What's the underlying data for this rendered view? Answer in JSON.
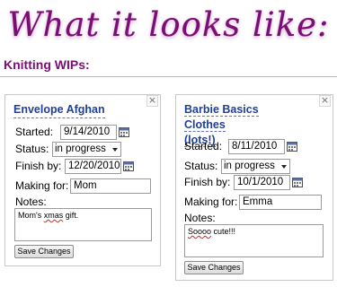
{
  "banner_text": "What it looks like:",
  "section_title": "Knitting WIPs:",
  "labels": {
    "started": "Started:",
    "status": "Status:",
    "finish_by": "Finish by:",
    "making_for": "Making for:",
    "notes": "Notes:",
    "save": "Save Changes",
    "close": "×"
  },
  "cards": [
    {
      "title": "Envelope Afghan",
      "started": "9/14/2010",
      "status": "in progress",
      "finish_by": "12/20/2010",
      "making_for": "Mom",
      "notes_part1": "Mom's ",
      "notes_misspelled": "xmas",
      "notes_part2": " gift."
    },
    {
      "title_line1": "Barbie Basics Clothes",
      "title_line2": "(lots!)",
      "started": "8/11/2010",
      "status": "in progress",
      "finish_by": "10/1/2010",
      "making_for": "Emma",
      "notes_part1": "",
      "notes_misspelled": "Soooo",
      "notes_part2": " cute!!!"
    }
  ],
  "icons": {
    "calendar": "calendar-icon",
    "close": "close-icon",
    "dropdown": "chevron-down-icon"
  },
  "colors": {
    "banner": "#7a0f73",
    "section_title": "#7a0f73",
    "card_title": "#1f3f99"
  }
}
